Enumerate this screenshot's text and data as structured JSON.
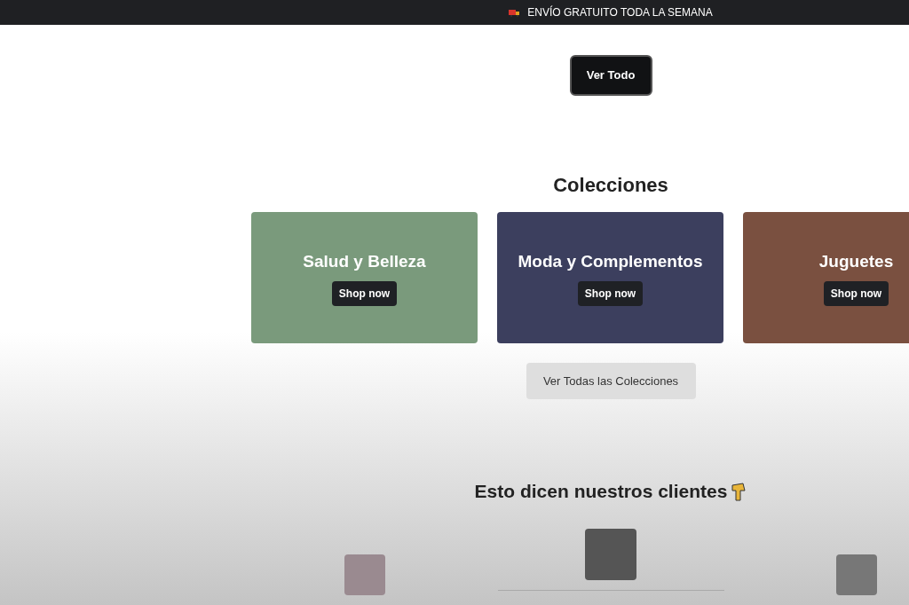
{
  "announcement": {
    "text": "ENVÍO GRATUITO TODA LA SEMANA"
  },
  "view_all_button": {
    "label": "Ver Todo"
  },
  "collections": {
    "title": "Colecciones",
    "items": [
      {
        "title": "Salud y Belleza",
        "button": "Shop now",
        "color": "#7a9a7c"
      },
      {
        "title": "Moda y Complementos",
        "button": "Shop now",
        "color": "#3c3f5e"
      },
      {
        "title": "Juguetes",
        "button": "Shop now",
        "color": "#7a5040"
      }
    ],
    "view_all_button": "Ver Todas las Colecciones"
  },
  "testimonials": {
    "title": "Esto dicen nuestros clientes"
  }
}
